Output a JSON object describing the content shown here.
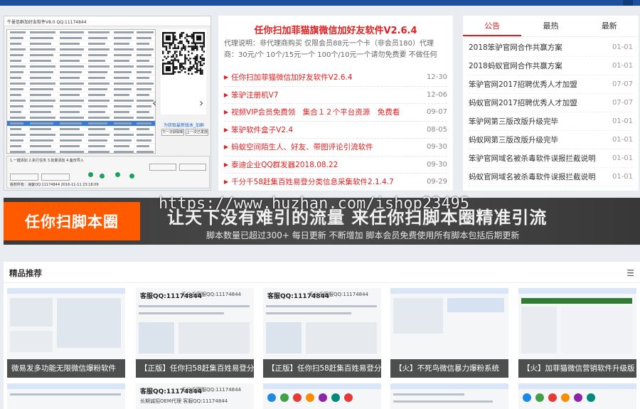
{
  "preview": {
    "title": "牛曼信群加好友软件V8.0 QQ:11174844",
    "qr_link": "为获取最新版本_加群",
    "btn_download": "下一次获取新版",
    "btn_send": "上一次已发放",
    "lower_legend": "1.一键添加  2.执行任务  3.批量添加  4.备份导入",
    "footer": "版权所有：海客QQ:11174844   2016-11-11 23:18:09"
  },
  "news": {
    "title": "任你扫加菲猫旗微信加好友软件V2.6.4",
    "description": "代理说明：非代理商购买 仅限会员88元一个卡（非会员180）代理商：30元/个 10个/15元一个 100个/10元一个请勿免费要 不做任何",
    "items": [
      {
        "title": "任你扫加菲猫微信加好友软件V2.6.4",
        "date": "12-30"
      },
      {
        "title": "笨驴注册机V7",
        "date": "12-06"
      },
      {
        "title": "视频VIP会员免费领　集合１２个平台资源　免费看",
        "date": "09-07"
      },
      {
        "title": "笨驴软件盒子V2.4",
        "date": "08-05"
      },
      {
        "title": "蚂蚁空间陌生人、好友、带图评论引流软件",
        "date": "09-30"
      },
      {
        "title": "泰迪企业QQ群发器2018.08.22",
        "date": "09-30"
      },
      {
        "title": "千分千58赶集百姓易登分类信息采集软件2.1.4.7",
        "date": "09-29"
      }
    ]
  },
  "notice": {
    "tabs": [
      "公告",
      "最热",
      "最新"
    ],
    "items": [
      {
        "title": "2018笨驴官网合作共赢方案",
        "date": "01-01"
      },
      {
        "title": "2018蚂蚁官网合作共赢方案",
        "date": "01-01"
      },
      {
        "title": "笨驴官网2017招聘优秀人才加盟",
        "date": "07-07"
      },
      {
        "title": "蚂蚁官网2017招聘优秀人才加盟",
        "date": "07-07"
      },
      {
        "title": "笨驴网第三版改版升级完毕",
        "date": "01-01"
      },
      {
        "title": "蚂蚁网第三版改版升级完毕",
        "date": "01-01"
      },
      {
        "title": "笨驴官网域名被杀毒软件误报拦截说明",
        "date": "01-01"
      },
      {
        "title": "蚂蚁官网域名被杀毒软件误报拦截说明",
        "date": "01-01"
      }
    ]
  },
  "banner": {
    "logo": "任你扫脚本圈",
    "slogan": "让天下没有难引的流量 来任你扫脚本圈精准引流",
    "sub": "脚本数量已超过300+ 每日更新 不断增加 脚本会员免费使用所有脚本包括后期更新",
    "watermark": "https://www.huzhan.com/ishop23495"
  },
  "picks": {
    "heading": "精品推荐",
    "menu_icon": "list-icon",
    "cards": [
      {
        "caption": "微易发多功能无限微信爆粉软件"
      },
      {
        "caption": "【正版】任你扫58赶集百姓易登分",
        "qq": "客服QQ:11174844",
        "qq2": "千分千客服QQ:11174844"
      },
      {
        "caption": "【正版】任你扫58赶集百姓易登分",
        "qq": "客服QQ:11174844",
        "qq2": "千分千客服QQ:11174844"
      },
      {
        "caption": "【火】不死鸟微信暴力爆粉系统"
      },
      {
        "caption": "【火】加菲猫微信营销软件升级版"
      }
    ],
    "lower": {
      "qq": "客服QQ:11174844",
      "qq2": "千分千客服QQ:11174844",
      "oem": "长期诚招OEM代理 客服QQ:11174844"
    }
  },
  "colors": {
    "accent_red": "#e02020",
    "banner_orange": "#ff5a00",
    "top_blue": "#1e4f9c"
  }
}
